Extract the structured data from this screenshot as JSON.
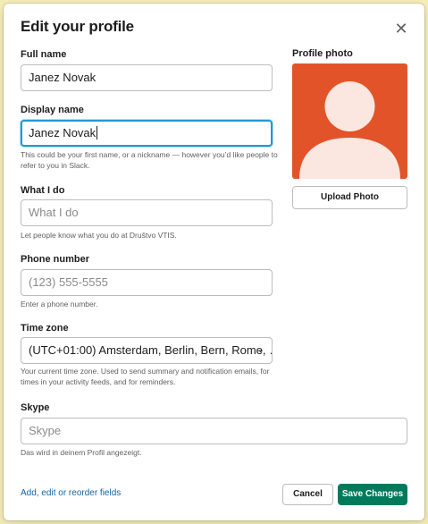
{
  "modal": {
    "title": "Edit your profile",
    "close_icon": "close-icon"
  },
  "form": {
    "full_name": {
      "label": "Full name",
      "value": "Janez Novak"
    },
    "display_name": {
      "label": "Display name",
      "value": "Janez Novak",
      "hint": "This could be your first name, or a nickname — however you’d like people to refer to you in Slack."
    },
    "what_i_do": {
      "label": "What I do",
      "placeholder": "What I do",
      "hint": "Let people know what you do at Društvo VTIS."
    },
    "phone": {
      "label": "Phone number",
      "placeholder": "(123) 555-5555",
      "hint": "Enter a phone number."
    },
    "time_zone": {
      "label": "Time zone",
      "value": "(UTC+01:00) Amsterdam, Berlin, Bern, Rome, …",
      "hint": "Your current time zone. Used to send summary and notification emails, for times in your activity feeds, and for reminders."
    },
    "skype": {
      "label": "Skype",
      "placeholder": "Skype",
      "hint": "Das wird in deinem Profil angezeigt."
    }
  },
  "photo": {
    "label": "Profile photo",
    "upload_label": "Upload Photo",
    "background_color": "#e2532a",
    "avatar_color": "#fbe6e0"
  },
  "footer": {
    "link_label": "Add, edit or reorder fields",
    "cancel_label": "Cancel",
    "save_label": "Save Changes",
    "save_color": "#007a5a"
  }
}
